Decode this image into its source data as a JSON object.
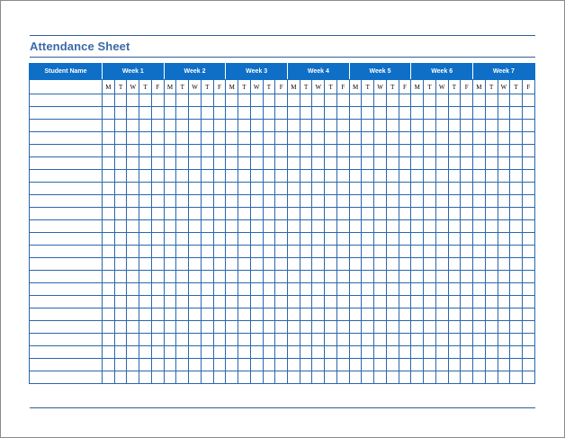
{
  "document": {
    "title": "Attendance Sheet"
  },
  "table": {
    "name_header": "Student Name",
    "weeks": [
      "Week 1",
      "Week 2",
      "Week 3",
      "Week 4",
      "Week 5",
      "Week 6",
      "Week 7"
    ],
    "days": [
      "M",
      "T",
      "W",
      "T",
      "F"
    ],
    "empty_rows": 23
  },
  "colors": {
    "header_fill": "#0f6fc6",
    "grid_line": "#2a67ad",
    "title_text": "#3a6aa8"
  }
}
